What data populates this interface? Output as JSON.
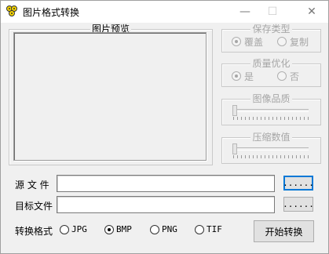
{
  "window": {
    "title": "图片格式转换",
    "minimize": "—",
    "maximize": "☐",
    "close": "✕"
  },
  "preview": {
    "title": "图片预览"
  },
  "save_type": {
    "title": "保存类型",
    "options": [
      "覆盖",
      "复制"
    ],
    "selected": 0
  },
  "quality_optimize": {
    "title": "质量优化",
    "options": [
      "是",
      "否"
    ],
    "selected": 0
  },
  "image_quality": {
    "title": "图像品质",
    "level": 0
  },
  "compress_value": {
    "title": "压缩数值",
    "level": 0
  },
  "source_file": {
    "label": "源 文 件",
    "value": "",
    "browse_label": "......"
  },
  "target_file": {
    "label": "目标文件",
    "value": "",
    "browse_label": "......"
  },
  "format": {
    "label": "转换格式",
    "options": [
      "JPG",
      "BMP",
      "PNG",
      "TIF"
    ],
    "selected": 1
  },
  "start_button": {
    "label": "开始转换"
  },
  "colors": {
    "disabled_text": "#a6a6a6",
    "focus_border": "#0078d7"
  }
}
